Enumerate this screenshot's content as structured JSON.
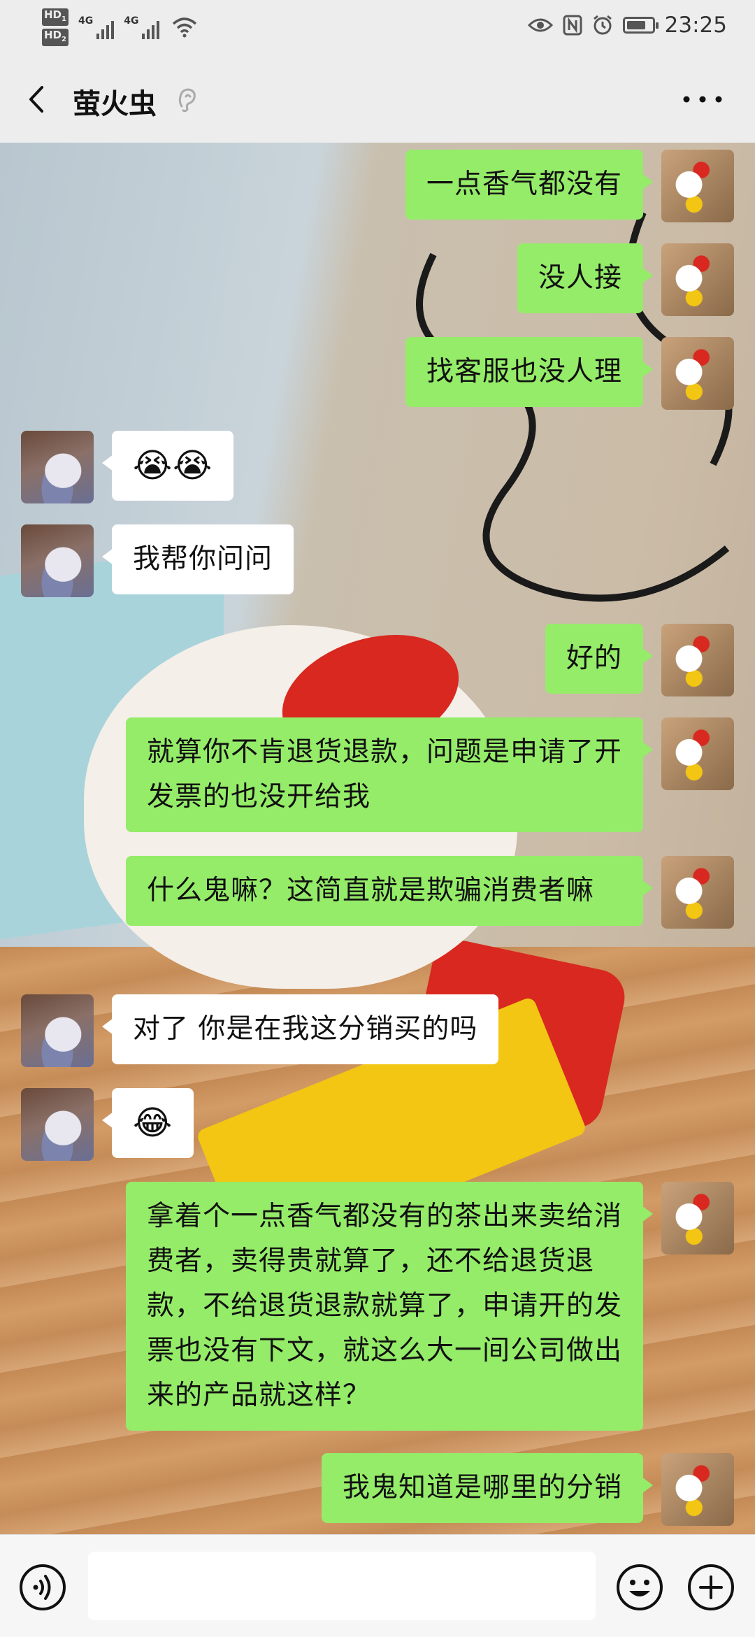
{
  "status_bar": {
    "sim1": "HD",
    "sim1_num": "1",
    "sim2": "HD",
    "sim2_num": "2",
    "net1": "4G",
    "net2": "4G",
    "time": "23:25",
    "battery_level": 0.75,
    "icons": [
      "eye-icon",
      "nfc-icon",
      "alarm-icon",
      "battery-icon"
    ]
  },
  "header": {
    "title": "萤火虫",
    "back_icon": "chevron-left-icon",
    "ear_icon": "ear-icon",
    "more_icon": "more-dots-icon"
  },
  "messages": [
    {
      "from": "me",
      "text": "一点香气都没有"
    },
    {
      "from": "me",
      "text": "没人接"
    },
    {
      "from": "me",
      "text": "找客服也没人理"
    },
    {
      "from": "other",
      "text": "😭😭"
    },
    {
      "from": "other",
      "text": "我帮你问问"
    },
    {
      "from": "me",
      "text": "好的"
    },
    {
      "from": "me",
      "text": "就算你不肯退货退款，问题是申请了开发票的也没开给我"
    },
    {
      "from": "me",
      "text": "什么鬼嘛？这简直就是欺骗消费者嘛"
    },
    {
      "from": "other",
      "text": "对了 你是在我这分销买的吗"
    },
    {
      "from": "other",
      "text": "😂"
    },
    {
      "from": "me",
      "text": "拿着个一点香气都没有的茶出来卖给消费者，卖得贵就算了，还不给退货退款，不给退货退款就算了，申请开的发票也没有下文，就这么大一间公司做出来的产品就这样？"
    },
    {
      "from": "me",
      "text": "我鬼知道是哪里的分销"
    }
  ],
  "input_bar": {
    "voice_icon": "voice-icon",
    "input_value": "",
    "emoji_icon": "emoji-icon",
    "plus_icon": "plus-icon"
  },
  "colors": {
    "my_bubble": "#95ec69",
    "other_bubble": "#ffffff",
    "bar_bg": "#ededed"
  }
}
